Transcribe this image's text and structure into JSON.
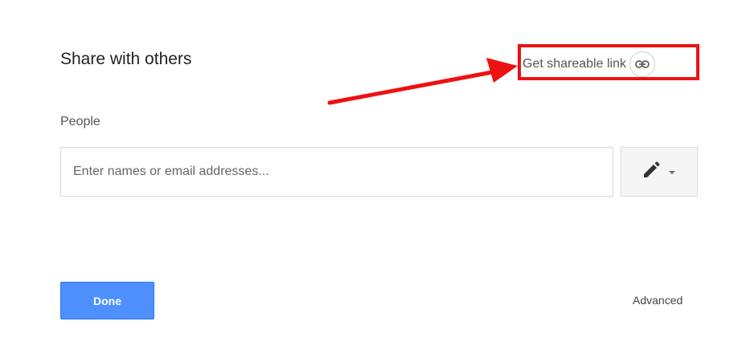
{
  "dialog": {
    "title": "Share with others",
    "share_link_label": "Get shareable link",
    "people_label": "People",
    "people_input": {
      "placeholder": "Enter names or email addresses...",
      "value": ""
    },
    "permission_icon": "pencil-icon",
    "done_label": "Done",
    "advanced_label": "Advanced"
  },
  "annotation": {
    "highlight_color": "#ee1111",
    "arrow_color": "#ee1111"
  },
  "colors": {
    "primary_button": "#4d90fe",
    "text_dark": "#222222",
    "text_muted": "#555555"
  }
}
